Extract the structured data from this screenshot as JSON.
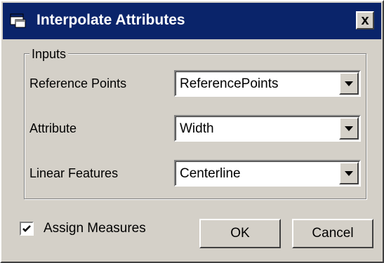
{
  "window": {
    "title": "Interpolate Attributes",
    "close_label": "x",
    "app_icon": "window-app-icon"
  },
  "inputs_group": {
    "legend": "Inputs",
    "fields": [
      {
        "label": "Reference Points",
        "value": "ReferencePoints"
      },
      {
        "label": "Attribute",
        "value": "Width"
      },
      {
        "label": "Linear Features",
        "value": "Centerline"
      }
    ]
  },
  "assign_measures": {
    "label": "Assign Measures",
    "checked": true
  },
  "buttons": {
    "ok": "OK",
    "cancel": "Cancel"
  },
  "colors": {
    "titlebar": "#0a246a",
    "face": "#d4d0c8"
  }
}
